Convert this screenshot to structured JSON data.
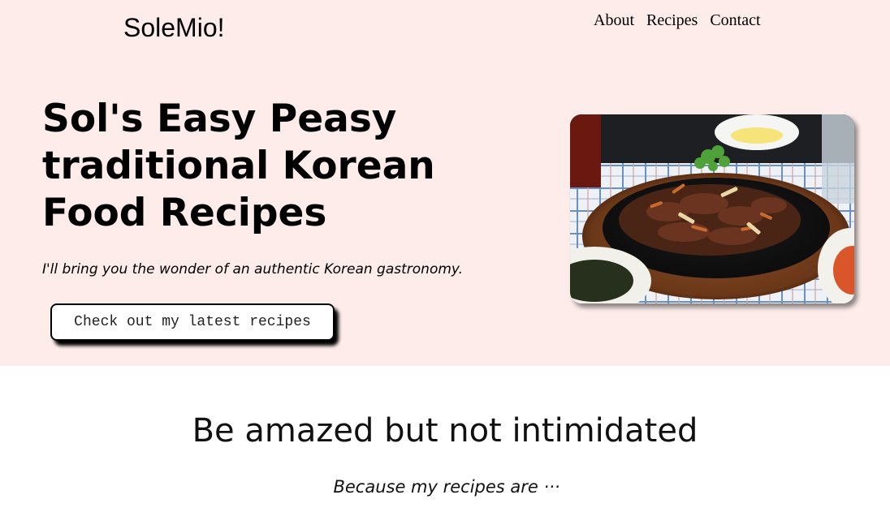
{
  "header": {
    "brand": "SoleMio!",
    "nav": [
      {
        "label": "About"
      },
      {
        "label": "Recipes"
      },
      {
        "label": "Contact"
      }
    ]
  },
  "hero": {
    "title": "Sol's Easy Peasy traditional Korean Food Recipes",
    "subtitle": "I'll bring you the wonder of an authentic Korean gastronomy.",
    "cta_label": "Check out my latest recipes",
    "image_alt": "Korean bulgogi on a sizzling plate",
    "background_color": "#fdecea"
  },
  "intro": {
    "title": "Be amazed but not intimidated",
    "subtitle": "Because my recipes are ···"
  }
}
